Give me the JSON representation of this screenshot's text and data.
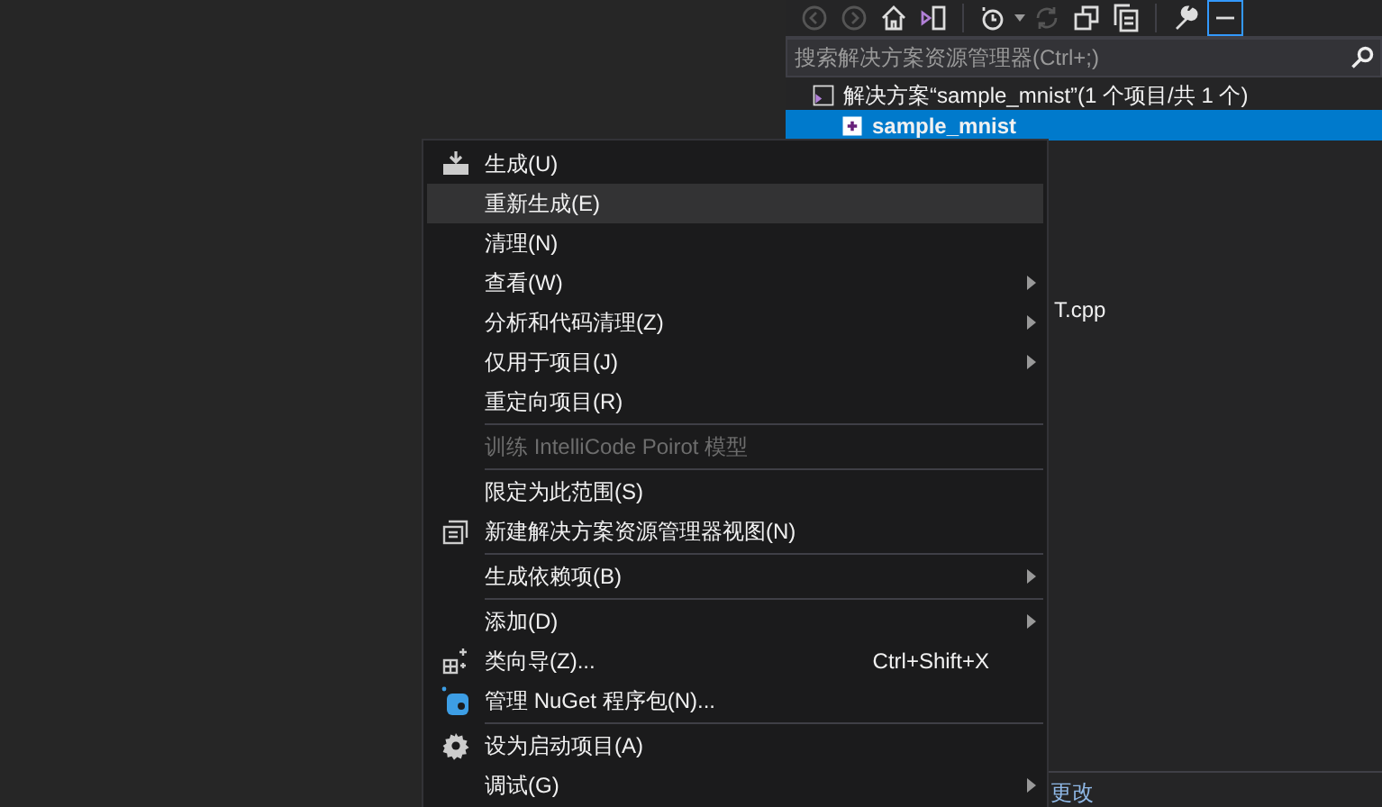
{
  "explorer": {
    "search": {
      "placeholder": "搜索解决方案资源管理器(Ctrl+;)"
    },
    "tree": [
      {
        "label": "解决方案“sample_mnist”(1 个项目/共 1 个)",
        "kind": "solution",
        "selected": false
      },
      {
        "label": "sample_mnist",
        "kind": "project",
        "selected": true
      },
      {
        "label": "T.cpp",
        "kind": "file",
        "selected": false
      }
    ],
    "bottom_panel": {
      "label": "更改"
    }
  },
  "context_menu": [
    {
      "kind": "build",
      "label": "生成(U)",
      "highlighted": false
    },
    {
      "kind": "plain",
      "label": "重新生成(E)",
      "highlighted": true
    },
    {
      "kind": "plain",
      "label": "清理(N)",
      "highlighted": false
    },
    {
      "kind": "plain",
      "label": "查看(W)",
      "highlighted": false,
      "submenu": true
    },
    {
      "kind": "plain",
      "label": "分析和代码清理(Z)",
      "highlighted": false,
      "submenu": true
    },
    {
      "kind": "plain",
      "label": "仅用于项目(J)",
      "highlighted": false,
      "submenu": true
    },
    {
      "kind": "plain",
      "label": "重定向项目(R)",
      "highlighted": false
    },
    {
      "kind": "separator"
    },
    {
      "kind": "plain",
      "label": "训练 IntelliCode Poirot 模型",
      "highlighted": false,
      "disabled": true
    },
    {
      "kind": "separator"
    },
    {
      "kind": "plain",
      "label": "限定为此范围(S)",
      "highlighted": false
    },
    {
      "kind": "view",
      "label": "新建解决方案资源管理器视图(N)",
      "highlighted": false
    },
    {
      "kind": "separator"
    },
    {
      "kind": "plain",
      "label": "生成依赖项(B)",
      "highlighted": false,
      "submenu": true
    },
    {
      "kind": "separator"
    },
    {
      "kind": "plain",
      "label": "添加(D)",
      "highlighted": false,
      "submenu": true
    },
    {
      "kind": "wizard",
      "label": "类向导(Z)...",
      "highlighted": false,
      "shortcut": "Ctrl+Shift+X"
    },
    {
      "kind": "package",
      "label": "管理 NuGet 程序包(N)...",
      "highlighted": false
    },
    {
      "kind": "separator"
    },
    {
      "kind": "gear",
      "label": "设为启动项目(A)",
      "highlighted": false
    },
    {
      "kind": "plain",
      "label": "调试(G)",
      "highlighted": false,
      "submenu": true
    }
  ]
}
